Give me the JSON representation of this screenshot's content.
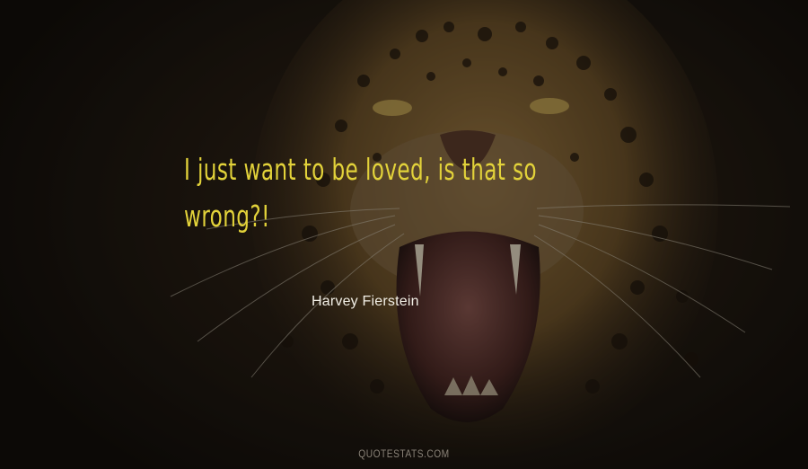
{
  "quote": {
    "lines": [
      "I just want to be loved, is that so",
      "wrong?!"
    ]
  },
  "author": "Harvey Fierstein",
  "watermark": "QUOTESTATS.COM",
  "colors": {
    "quote_text": "#e2d23a",
    "author_text": "#f2efe6",
    "watermark_text": "#8a8378",
    "background_dark": "#15110c",
    "fur": "#8a6a36",
    "mouth": "#7a4a44"
  },
  "image": {
    "subject": "snarling-jaguar"
  }
}
